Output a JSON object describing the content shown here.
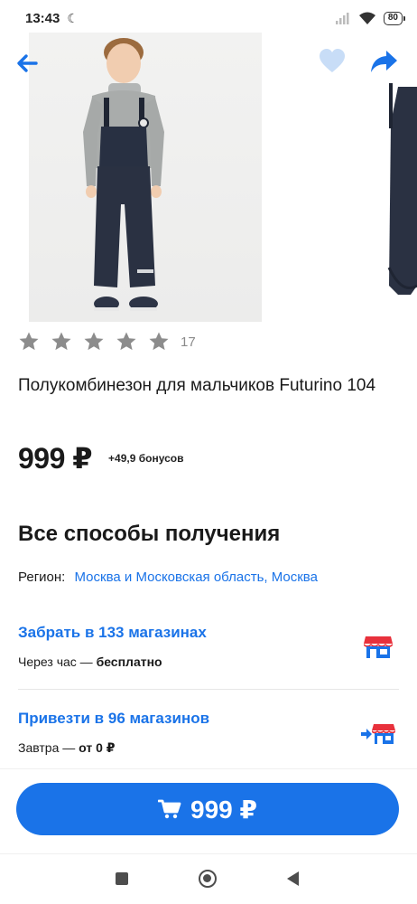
{
  "status_bar": {
    "time": "13:43",
    "battery": "80",
    "icons": [
      "moon-icon",
      "signal-icon",
      "wifi-icon",
      "battery-icon"
    ]
  },
  "header": {
    "back_icon": "arrow-left-icon",
    "favorite_icon": "heart-icon",
    "share_icon": "share-icon"
  },
  "product": {
    "rating": {
      "stars_filled": 0,
      "stars_total": 5,
      "count": "17"
    },
    "title": "Полукомбинезон для мальчиков Futurino 104",
    "price": "999 ₽",
    "bonus": "+49,9 бонусов"
  },
  "delivery": {
    "section_title": "Все способы получения",
    "region_label": "Регион:",
    "region_value": "Москва и Московская область, Москва",
    "options": [
      {
        "title": "Забрать в 133 магазинах",
        "sub_prefix": "Через час — ",
        "sub_value": "бесплатно",
        "icon": "store-icon"
      },
      {
        "title": "Привезти в 96 магазинов",
        "sub_prefix": "Завтра — ",
        "sub_value": "от 0 ₽",
        "icon": "store-delivery-icon"
      }
    ]
  },
  "cta": {
    "label": "999 ₽",
    "icon": "cart-icon"
  },
  "colors": {
    "accent": "#1a73e8",
    "store_red": "#e8313c",
    "store_blue": "#1a73e8",
    "star_gray": "#8c8c8c",
    "heart_light": "#c8ddf7"
  }
}
